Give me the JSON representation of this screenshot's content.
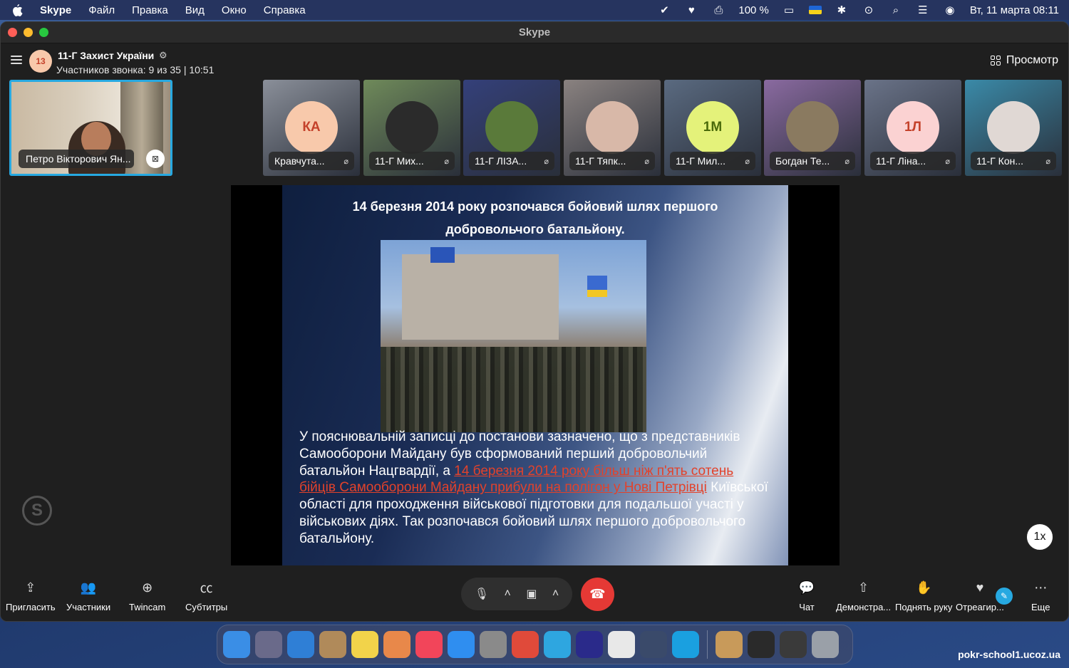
{
  "menubar": {
    "app_name": "Skype",
    "menus": [
      "Файл",
      "Правка",
      "Вид",
      "Окно",
      "Справка"
    ],
    "battery": "100 %",
    "datetime": "Вт, 11 марта  08:11"
  },
  "window": {
    "title": "Skype"
  },
  "call": {
    "group_avatar": "13",
    "group_name": "11-Г Захист України",
    "subtitle": "Участников звонка: 9 из 35 | 10:51",
    "view_label": "Просмотр"
  },
  "self_video": {
    "name": "Петро Вікторович Ян..."
  },
  "participants": [
    {
      "name": "Кравчута...",
      "initials": "КА",
      "avatar_bg": "#f8c9ab",
      "avatar_fg": "#c4412a",
      "tile_bg": "#8a8f99"
    },
    {
      "name": "11-Г Мих...",
      "initials": "",
      "avatar_bg": "#2b2b2b",
      "avatar_fg": "#ffffff",
      "tile_bg": "#6f8a5a"
    },
    {
      "name": "11-Г ЛІЗА...",
      "initials": "",
      "avatar_bg": "#5a7a3a",
      "avatar_fg": "#ffffff",
      "tile_bg": "#34407a"
    },
    {
      "name": "11-Г Тяпк...",
      "initials": "",
      "avatar_bg": "#d8b8a8",
      "avatar_fg": "#ffffff",
      "tile_bg": "#8a8280"
    },
    {
      "name": "11-Г Мил...",
      "initials": "1М",
      "avatar_bg": "#e4f27a",
      "avatar_fg": "#4a6a0a",
      "tile_bg": "#5a6a80"
    },
    {
      "name": "Богдан Те...",
      "initials": "",
      "avatar_bg": "#8a7a60",
      "avatar_fg": "#ffffff",
      "tile_bg": "#8a6aa0"
    },
    {
      "name": "11-Г Ліна...",
      "initials": "1Л",
      "avatar_bg": "#fbd2d2",
      "avatar_fg": "#c4412a",
      "tile_bg": "#6a7388"
    },
    {
      "name": "11-Г Кон...",
      "initials": "",
      "avatar_bg": "#e0d8d4",
      "avatar_fg": "#ffffff",
      "tile_bg": "#3a8aa8"
    }
  ],
  "slide": {
    "title": "14 березня 2014 року розпочався бойовий шлях першого добровольчого батальйону.",
    "text_before": "У пояснювальній записці до постанови зазначено, що з представників Самооборони Майдану був сформований перший добровольчий батальйон Нацгвардії, а ",
    "text_link": "14 березня 2014 року більш ніж п'ять сотень бійців Самооборони Майдану прибули на полігон у Нові Петрівці",
    "text_after": " Київської області для проходження військової підготовки для подальшої участі у військових діях. Так розпочався бойовий шлях першого добровольчого батальйону."
  },
  "speed": "1x",
  "toolbar": {
    "invite": "Пригласить",
    "participants": "Участники",
    "twincam": "Twincam",
    "subtitles": "Субтитры",
    "chat": "Чат",
    "share": "Демонстра...",
    "raise_hand": "Поднять руку",
    "react": "Отреагир...",
    "more": "Еще"
  },
  "dock_apps": [
    {
      "name": "finder",
      "color": "#3a8ee6"
    },
    {
      "name": "launchpad",
      "color": "#6a6a8a"
    },
    {
      "name": "safari",
      "color": "#2f7fd6"
    },
    {
      "name": "contacts",
      "color": "#b08a5a"
    },
    {
      "name": "notes",
      "color": "#f2d34a"
    },
    {
      "name": "photos",
      "color": "#e8884a"
    },
    {
      "name": "music",
      "color": "#f2455a"
    },
    {
      "name": "app-store",
      "color": "#2f8ef0"
    },
    {
      "name": "settings",
      "color": "#8a8a8a"
    },
    {
      "name": "chrome",
      "color": "#e04a3a"
    },
    {
      "name": "telegram",
      "color": "#2ea6e0"
    },
    {
      "name": "radio",
      "color": "#2a2a8a"
    },
    {
      "name": "installer",
      "color": "#e8e8e8"
    },
    {
      "name": "help",
      "color": "#3a4a6a"
    },
    {
      "name": "skype",
      "color": "#1aa0e0"
    }
  ],
  "dock_right": [
    {
      "name": "archive",
      "color": "#c89a5a"
    },
    {
      "name": "terminal",
      "color": "#2a2a2a"
    },
    {
      "name": "screen",
      "color": "#3a3a3a"
    },
    {
      "name": "trash",
      "color": "#9aa0a8"
    }
  ],
  "site_url": "pokr-school1.ucoz.ua"
}
